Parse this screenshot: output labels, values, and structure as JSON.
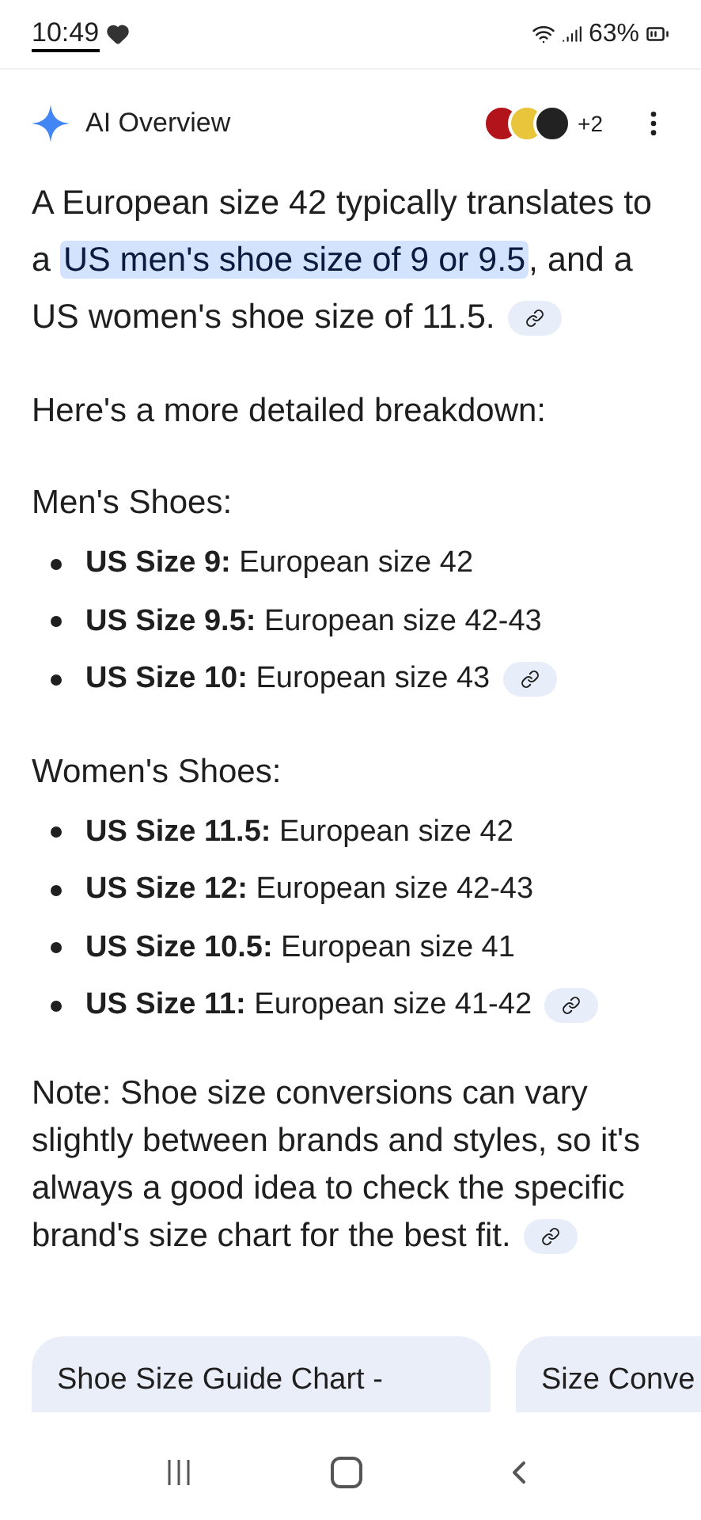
{
  "status_bar": {
    "time": "10:49",
    "battery": "63%"
  },
  "header": {
    "title": "AI Overview",
    "more_sources": "+2"
  },
  "intro": {
    "segments": [
      {
        "text": "A European size 42 typically translates to a ",
        "highlighted": false
      },
      {
        "text": "US men's shoe size of 9 or 9.5",
        "highlighted": true
      },
      {
        "text": ", and a US women's shoe size of 11.5.",
        "highlighted": false
      }
    ],
    "has_link": true
  },
  "lead": "Here's a more detailed breakdown:",
  "sections": [
    {
      "heading": "Men's Shoes:",
      "items": [
        {
          "text": "**US Size 9:** European size 42",
          "has_link": false
        },
        {
          "text": "**US Size 9.5:** European size 42-43",
          "has_link": false
        },
        {
          "text": "**US Size 10:** European size 43",
          "has_link": true
        }
      ]
    },
    {
      "heading": "Women's Shoes:",
      "items": [
        {
          "text": "**US Size 11.5:** European size 42",
          "has_link": false
        },
        {
          "text": "**US Size 12:** European size 42-43",
          "has_link": false
        },
        {
          "text": "**US Size 10.5:** European size 41",
          "has_link": false
        },
        {
          "text": "**US Size 11:** European size 41-42",
          "has_link": true
        }
      ]
    }
  ],
  "note": {
    "text": "Note: Shoe size conversions can vary slightly between brands and styles, so it's always a good idea to check the specific brand's size chart for the best fit.",
    "has_link": true
  },
  "cards": [
    {
      "title": "Shoe Size Guide Chart -"
    },
    {
      "title": "Size Conve"
    }
  ]
}
